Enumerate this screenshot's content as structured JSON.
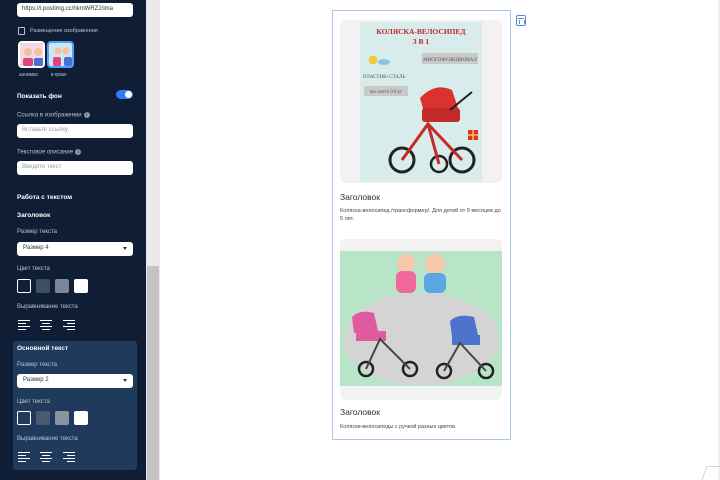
{
  "sidebar": {
    "image_url": "https://i.postimg.cc/hkmWRZ2/ima",
    "placement_label": "Размещение изображения",
    "placement_options": [
      {
        "label": "занимко",
        "selected": false
      },
      {
        "label": "в краю",
        "selected": true
      }
    ],
    "show_bg_label": "Показать фон",
    "show_bg_enabled": true,
    "image_link_label": "Ссылка в изображении",
    "image_link_placeholder": "Вставьте ссылку",
    "alt_text_label": "Текстовое описание",
    "alt_text_placeholder": "Введите текст",
    "text_section_title": "Работа с текстом",
    "heading_section": {
      "title": "Заголовок",
      "size_label": "Размер текста",
      "size_value": "Размер 4",
      "color_label": "Цвет текста",
      "colors": [
        "#0f1e35",
        "#3e4e63",
        "#7b8794",
        "#ffffff"
      ],
      "selected_color_index": 0,
      "align_label": "Выравнивание текста"
    },
    "body_section": {
      "title": "Основной текст",
      "size_label": "Размер текста",
      "size_value": "Размер 2",
      "color_label": "Цвет текста",
      "colors": [
        "#1f3a5c",
        "#4a5a70",
        "#8a94a0",
        "#ffffff"
      ],
      "selected_color_index": 0,
      "align_label": "Выравнивание текста"
    }
  },
  "cards": [
    {
      "title": "Заголовок",
      "description": "Коляска-велосипед /трансформер/. Для детей от 9 месяцев до 5 лет.",
      "image_text": {
        "headline": "КОЛЯСКА-ВЕЛОСИПЕД",
        "subhead": "3 В 1",
        "tag1": "МНОГОФУНКЦИОНАЛ",
        "tag2": "ПЛАСТИК+СТАЛЬ",
        "tag3": "вес нетто 9.6 кг"
      }
    },
    {
      "title": "Заголовок",
      "description": "Коляски-велосипеды с ручкой разных цветов."
    }
  ],
  "icons": {
    "delete": "trash-icon",
    "info": "info-icon",
    "image": "image-icon",
    "dropdown": "chevron-down-icon"
  },
  "colors": {
    "sidebar_bg": "#0f1e35",
    "panel_bg": "#1f3a5c",
    "accent": "#2f7cf6",
    "frame": "#a9c8ea"
  }
}
